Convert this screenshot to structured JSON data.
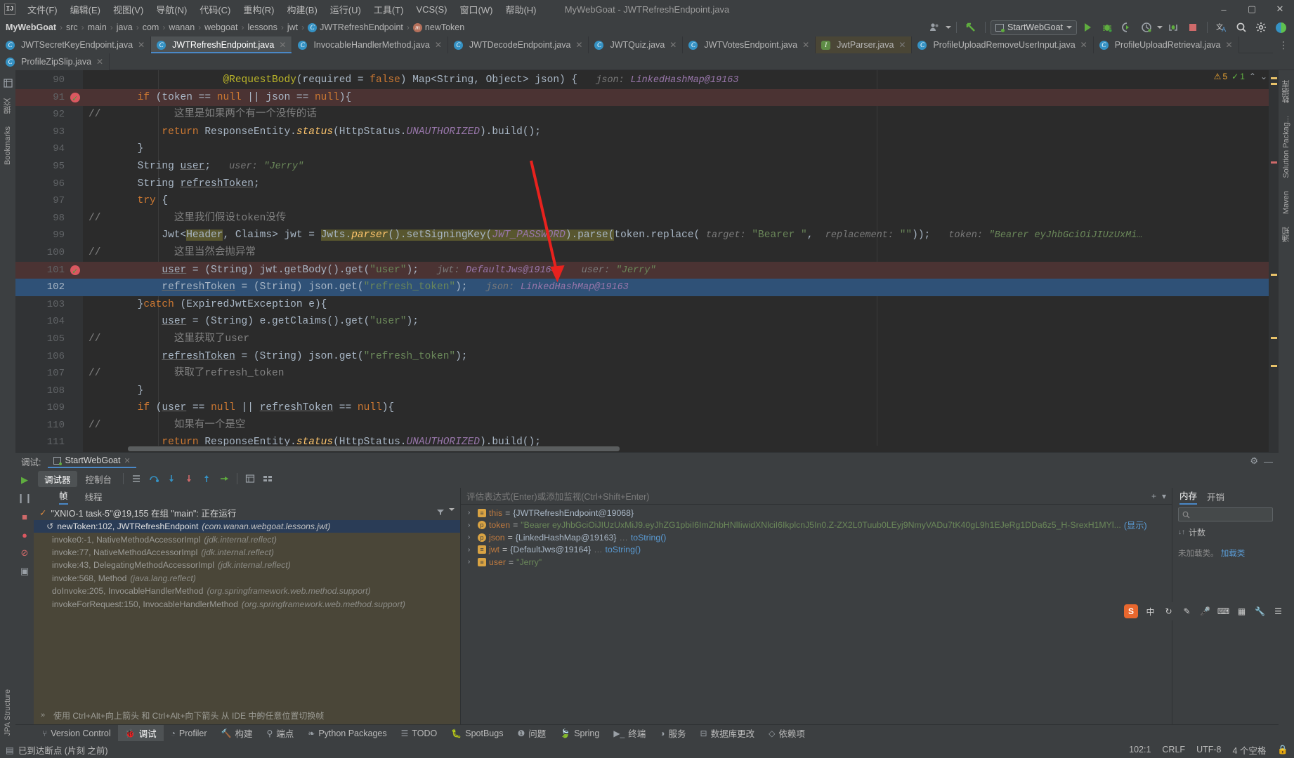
{
  "window": {
    "title": "MyWebGoat - JWTRefreshEndpoint.java",
    "logo": "IJ",
    "minimize": "–",
    "maximize": "▢",
    "close": "✕"
  },
  "menu": {
    "items": [
      {
        "label": "文件(F)"
      },
      {
        "label": "编辑(E)"
      },
      {
        "label": "视图(V)"
      },
      {
        "label": "导航(N)"
      },
      {
        "label": "代码(C)"
      },
      {
        "label": "重构(R)"
      },
      {
        "label": "构建(B)"
      },
      {
        "label": "运行(U)"
      },
      {
        "label": "工具(T)"
      },
      {
        "label": "VCS(S)"
      },
      {
        "label": "窗口(W)"
      },
      {
        "label": "帮助(H)"
      }
    ]
  },
  "navbar": {
    "crumbs": [
      {
        "label": "MyWebGoat",
        "icon": "",
        "bold": true
      },
      {
        "label": "src",
        "icon": ""
      },
      {
        "label": "main",
        "icon": ""
      },
      {
        "label": "java",
        "icon": ""
      },
      {
        "label": "com",
        "icon": ""
      },
      {
        "label": "wanan",
        "icon": ""
      },
      {
        "label": "webgoat",
        "icon": ""
      },
      {
        "label": "lessons",
        "icon": ""
      },
      {
        "label": "jwt",
        "icon": ""
      },
      {
        "label": "JWTRefreshEndpoint",
        "icon": "C"
      },
      {
        "label": "newToken",
        "icon": "m"
      }
    ],
    "separator": "›",
    "run_config": "StartWebGoat",
    "icons": {
      "avatar": "avatar-icon",
      "update": "update-icon",
      "run": "run-icon",
      "debug": "debug-icon",
      "coverage": "coverage-icon",
      "profile": "profile-icon",
      "build": "build-icon",
      "stop": "stop-icon",
      "translate": "translate-icon",
      "search": "search-icon",
      "settings": "settings-icon",
      "ai": "ai-icon"
    }
  },
  "editor_tabs": {
    "row1": [
      {
        "label": "JWTSecretKeyEndpoint.java",
        "icon": "C",
        "active": false,
        "modified": false
      },
      {
        "label": "JWTRefreshEndpoint.java",
        "icon": "C",
        "active": true,
        "modified": false
      },
      {
        "label": "InvocableHandlerMethod.java",
        "icon": "C",
        "active": false,
        "modified": false
      },
      {
        "label": "JWTDecodeEndpoint.java",
        "icon": "C",
        "active": false,
        "modified": false
      },
      {
        "label": "JWTQuiz.java",
        "icon": "C",
        "active": false,
        "modified": false
      },
      {
        "label": "JWTVotesEndpoint.java",
        "icon": "C",
        "active": false,
        "modified": false
      },
      {
        "label": "JwtParser.java",
        "icon": "I",
        "active": false,
        "modified": true
      },
      {
        "label": "ProfileUploadRemoveUserInput.java",
        "icon": "C",
        "active": false,
        "modified": false
      },
      {
        "label": "ProfileUploadRetrieval.java",
        "icon": "C",
        "active": false,
        "modified": false
      }
    ],
    "row2": [
      {
        "label": "ProfileZipSlip.java",
        "icon": "C",
        "active": false,
        "modified": false
      }
    ],
    "close_glyph": "✕",
    "overflow_glyph": "⋮"
  },
  "analysis": {
    "warnings": "5",
    "ok": "1",
    "warn_glyph": "⚠",
    "ok_glyph": "✓",
    "up_glyph": "⌃",
    "down_glyph": "⌄"
  },
  "code": {
    "first_line": 90,
    "lines": [
      {
        "n": 90,
        "bp": false,
        "hl": "",
        "html": "                      <span class=\"ann\">@RequestBody</span>(required = <span class=\"kw\">false</span>) Map&lt;String, Object&gt; json) {   <span class=\"hint\">json:</span> <span class=\"hintt\">LinkedHashMap@19163</span>"
      },
      {
        "n": 91,
        "bp": true,
        "hl": "red",
        "html": "        <span class=\"kw\">if</span> (token == <span class=\"kw\">null</span> || json == <span class=\"kw\">null</span>){"
      },
      {
        "n": 92,
        "bp": false,
        "hl": "",
        "html": "<span class=\"cmt\">//            这里是如果两个有一个没传的话</span>"
      },
      {
        "n": 93,
        "bp": false,
        "hl": "",
        "html": "            <span class=\"kw\">return</span> ResponseEntity.<span class=\"mth\" style=\"font-style:italic\">status</span>(HttpStatus.<span class=\"stc\">UNAUTHORIZED</span>).build();"
      },
      {
        "n": 94,
        "bp": false,
        "hl": "",
        "html": "        }"
      },
      {
        "n": 95,
        "bp": false,
        "hl": "",
        "html": "        String <span class=\"und\">user</span>;   <span class=\"hint\">user:</span> <span class=\"hintv\">\"Jerry\"</span>"
      },
      {
        "n": 96,
        "bp": false,
        "hl": "",
        "html": "        String <span class=\"und\">refreshToken</span>;"
      },
      {
        "n": 97,
        "bp": false,
        "hl": "",
        "html": "        <span class=\"kw\">try</span> {"
      },
      {
        "n": 98,
        "bp": false,
        "hl": "",
        "html": "<span class=\"cmt\">//            这里我们假设token没传</span>"
      },
      {
        "n": 99,
        "bp": false,
        "hl": "",
        "html": "            Jwt&lt;<span class=\"srch\">Header</span>, Claims&gt; jwt = <span class=\"srch\">Jwts.<span class=\"mth\" style=\"font-style:italic\">parser</span>().setSigningKey(<span class=\"stc\">JWT_PASSWORD</span>).parse(</span>token.replace( <span class=\"hint\">target:</span> <span class=\"str\">\"Bearer \"</span>,  <span class=\"hint\">replacement:</span> <span class=\"str\">\"\"</span>));   <span class=\"hint\">token:</span> <span class=\"hintv\">\"Bearer eyJhbGciOiJIUzUxMi…</span>"
      },
      {
        "n": 100,
        "bp": false,
        "hl": "",
        "html": "<span class=\"cmt\">//            这里当然会抛异常</span>"
      },
      {
        "n": 101,
        "bp": true,
        "hl": "red",
        "html": "            <span class=\"und\">user</span> = (String) jwt.getBody().get(<span class=\"str\">\"user\"</span>);   <span class=\"hint\">jwt:</span> <span class=\"hintt\">DefaultJws@19164</span>    <span class=\"hint\">user:</span> <span class=\"hintv\">\"Jerry\"</span>"
      },
      {
        "n": 102,
        "bp": false,
        "hl": "blue",
        "html": "            <span class=\"und\">refreshToken</span> = (String) json.get(<span class=\"str\">\"refresh_token\"</span>);   <span class=\"hint\">json:</span> <span class=\"hintt\">LinkedHashMap@19163</span>"
      },
      {
        "n": 103,
        "bp": false,
        "hl": "",
        "html": "        }<span class=\"kw\">catch</span> (ExpiredJwtException e){"
      },
      {
        "n": 104,
        "bp": false,
        "hl": "",
        "html": "            <span class=\"und\">user</span> = (String) e.getClaims().get(<span class=\"str\">\"user\"</span>);"
      },
      {
        "n": 105,
        "bp": false,
        "hl": "",
        "html": "<span class=\"cmt\">//            这里获取了user</span>"
      },
      {
        "n": 106,
        "bp": false,
        "hl": "",
        "html": "            <span class=\"und\">refreshToken</span> = (String) json.get(<span class=\"str\">\"refresh_token\"</span>);"
      },
      {
        "n": 107,
        "bp": false,
        "hl": "",
        "html": "<span class=\"cmt\">//            获取了refresh_token</span>"
      },
      {
        "n": 108,
        "bp": false,
        "hl": "",
        "html": "        }"
      },
      {
        "n": 109,
        "bp": false,
        "hl": "",
        "html": "        <span class=\"kw\">if</span> (<span class=\"und\">user</span> == <span class=\"kw\">null</span> || <span class=\"und\">refreshToken</span> == <span class=\"kw\">null</span>){"
      },
      {
        "n": 110,
        "bp": false,
        "hl": "",
        "html": "<span class=\"cmt\">//            如果有一个是空</span>"
      },
      {
        "n": 111,
        "bp": false,
        "hl": "",
        "html": "            <span class=\"kw\">return</span> ResponseEntity.<span class=\"mth\" style=\"font-style:italic\">status</span>(HttpStatus.<span class=\"stc\">UNAUTHORIZED</span>).build();"
      }
    ]
  },
  "debug": {
    "panel_title": "调试:",
    "session_tab": "StartWebGoat",
    "close_glyph": "✕",
    "gear_glyph": "⚙",
    "minimize_glyph": "—",
    "toolbar_tabs": [
      {
        "label": "调试器",
        "active": true
      },
      {
        "label": "控制台",
        "active": false
      }
    ],
    "toolbar_icons": [
      {
        "name": "step-over-icon",
        "glyph": "⤵"
      },
      {
        "name": "step-into-icon",
        "glyph": "↓"
      },
      {
        "name": "force-step-into-icon",
        "glyph": "⇣"
      },
      {
        "name": "step-out-icon",
        "glyph": "↑"
      },
      {
        "name": "run-to-cursor-icon",
        "glyph": "⇥"
      },
      {
        "name": "evaluate-icon",
        "glyph": "▤"
      },
      {
        "name": "layout-icon",
        "glyph": "▦"
      }
    ],
    "frames": {
      "subtabs": [
        {
          "label": "帧",
          "active": true
        },
        {
          "label": "线程",
          "active": false
        }
      ],
      "thread_status": "\"XNIO-1 task-5\"@19,155 在组 \"main\": 正在运行",
      "thread_check": "✓",
      "filter_glyph": "▼",
      "items": [
        {
          "label": "newToken:102, JWTRefreshEndpoint",
          "pkg": "(com.wanan.webgoat.lessons.jwt)",
          "selected": true,
          "glyph": "↺"
        },
        {
          "label": "invoke0:-1, NativeMethodAccessorImpl",
          "pkg": "(jdk.internal.reflect)",
          "selected": false,
          "glyph": ""
        },
        {
          "label": "invoke:77, NativeMethodAccessorImpl",
          "pkg": "(jdk.internal.reflect)",
          "selected": false,
          "glyph": ""
        },
        {
          "label": "invoke:43, DelegatingMethodAccessorImpl",
          "pkg": "(jdk.internal.reflect)",
          "selected": false,
          "glyph": ""
        },
        {
          "label": "invoke:568, Method",
          "pkg": "(java.lang.reflect)",
          "selected": false,
          "glyph": ""
        },
        {
          "label": "doInvoke:205, InvocableHandlerMethod",
          "pkg": "(org.springframework.web.method.support)",
          "selected": false,
          "glyph": ""
        },
        {
          "label": "invokeForRequest:150, InvocableHandlerMethod",
          "pkg": "(org.springframework.web.method.support)",
          "selected": false,
          "glyph": ""
        }
      ]
    },
    "variables": {
      "eval_placeholder": "评估表达式(Enter)或添加监视(Ctrl+Shift+Enter)",
      "add_glyph": "+",
      "caret_glyph": "▾",
      "rows": [
        {
          "arrow": "›",
          "icon": "obj",
          "icon_glyph": "≡",
          "name": "this",
          "eq": " = ",
          "value": "{JWTRefreshEndpoint@19068}",
          "value_class": "v-val",
          "more": "",
          "link": ""
        },
        {
          "arrow": "›",
          "icon": "par",
          "icon_glyph": "p",
          "name": "token",
          "eq": " = ",
          "value": "\"Bearer eyJhbGciOiJIUzUxMiJ9.eyJhZG1pbiI6ImZhbHNlIiwidXNlciI6IkplcnJ5In0.Z-ZX2L0Tuub0LEyj9NmyVADu7tK40gL9h1EJeRg1DDa6z5_H-SrexH1MYl...",
          "value_class": "v-str",
          "more": "",
          "link": "(显示)"
        },
        {
          "arrow": "›",
          "icon": "par",
          "icon_glyph": "p",
          "name": "json",
          "eq": " = ",
          "value": "{LinkedHashMap@19163}",
          "value_class": "v-val",
          "more": " … ",
          "link": "toString()"
        },
        {
          "arrow": "›",
          "icon": "obj",
          "icon_glyph": "≡",
          "name": "jwt",
          "eq": " = ",
          "value": "{DefaultJws@19164}",
          "value_class": "v-val",
          "more": " … ",
          "link": "toString()"
        },
        {
          "arrow": "›",
          "icon": "obj",
          "icon_glyph": "≡",
          "name": "user",
          "eq": " = ",
          "value": "\"Jerry\"",
          "value_class": "v-str",
          "more": "",
          "link": ""
        }
      ]
    },
    "memory": {
      "tabs": [
        {
          "label": "内存",
          "active": true
        },
        {
          "label": "开销",
          "active": false
        }
      ],
      "search_placeholder": "",
      "search_glyph": "🔍",
      "counts_label": "计数",
      "counts_glyph": "↓↑",
      "note": "未加载类。",
      "note_link": "加载类"
    },
    "hint_bar": {
      "text": "使用 Ctrl+Alt+向上箭头 和 Ctrl+Alt+向下箭头 从 IDE 中的任意位置切换帧",
      "chev": "»",
      "close": "✕"
    },
    "rail_icons": [
      {
        "name": "resume-icon",
        "glyph": "▶"
      },
      {
        "name": "pause-icon",
        "glyph": "❙❙"
      },
      {
        "name": "stop-icon",
        "glyph": "■"
      },
      {
        "name": "view-breakpoints-icon",
        "glyph": "●"
      },
      {
        "name": "mute-breakpoints-icon",
        "glyph": "⊘"
      },
      {
        "name": "camera-icon",
        "glyph": "▣"
      }
    ]
  },
  "left_rail": {
    "items": [
      {
        "label": "项目",
        "name": "sidebar-item-project"
      },
      {
        "label": "提交",
        "name": "sidebar-item-commit"
      },
      {
        "label": "Bookmarks",
        "name": "sidebar-item-bookmarks"
      },
      {
        "label": "JPA Structure",
        "name": "sidebar-item-jpa-structure"
      }
    ]
  },
  "right_rail": {
    "items": [
      {
        "label": "数据库",
        "name": "sidebar-item-database"
      },
      {
        "label": "Solution Packag...",
        "name": "sidebar-item-solution"
      },
      {
        "label": "Maven",
        "name": "sidebar-item-maven"
      },
      {
        "label": "通知",
        "name": "sidebar-item-notifications"
      }
    ]
  },
  "toolwindow_bar": {
    "items": [
      {
        "label": "Version Control",
        "glyph": "⑂",
        "active": false
      },
      {
        "label": "调试",
        "glyph": "🐞",
        "active": true
      },
      {
        "label": "Profiler",
        "glyph": "◔",
        "active": false
      },
      {
        "label": "构建",
        "glyph": "🔨",
        "active": false
      },
      {
        "label": "端点",
        "glyph": "⚲",
        "active": false
      },
      {
        "label": "Python Packages",
        "glyph": "❧",
        "active": false
      },
      {
        "label": "TODO",
        "glyph": "☰",
        "active": false
      },
      {
        "label": "SpotBugs",
        "glyph": "🐛",
        "active": false
      },
      {
        "label": "问题",
        "glyph": "❶",
        "active": false
      },
      {
        "label": "Spring",
        "glyph": "🍃",
        "active": false
      },
      {
        "label": "终端",
        "glyph": "▶_",
        "active": false
      },
      {
        "label": "服务",
        "glyph": "◑",
        "active": false
      },
      {
        "label": "数据库更改",
        "glyph": "⊟",
        "active": false
      },
      {
        "label": "依赖项",
        "glyph": "◇",
        "active": false
      }
    ]
  },
  "status_bar": {
    "left_glyph": "▤",
    "message": "已到达断点 (片刻 之前)",
    "position": "102:1",
    "line_sep": "CRLF",
    "encoding": "UTF-8",
    "indent": "4 个空格",
    "lock_glyph": "🔒"
  },
  "tray": {
    "sogou": "S",
    "items": [
      "中",
      "↻",
      "✎",
      "🎤",
      "⌨",
      "▦",
      "🔧",
      "☰"
    ]
  },
  "colors": {
    "accent": "#4a88c7",
    "breakpoint": "#db5860",
    "selected_line": "#2f5177",
    "exec_line": "#4b3333",
    "editor_bg": "#2b2b2b",
    "panel_bg": "#3c3f41",
    "frames_bg": "#4a4638",
    "string": "#6a8759",
    "keyword": "#cc7832",
    "arrow": "#e8221e"
  }
}
